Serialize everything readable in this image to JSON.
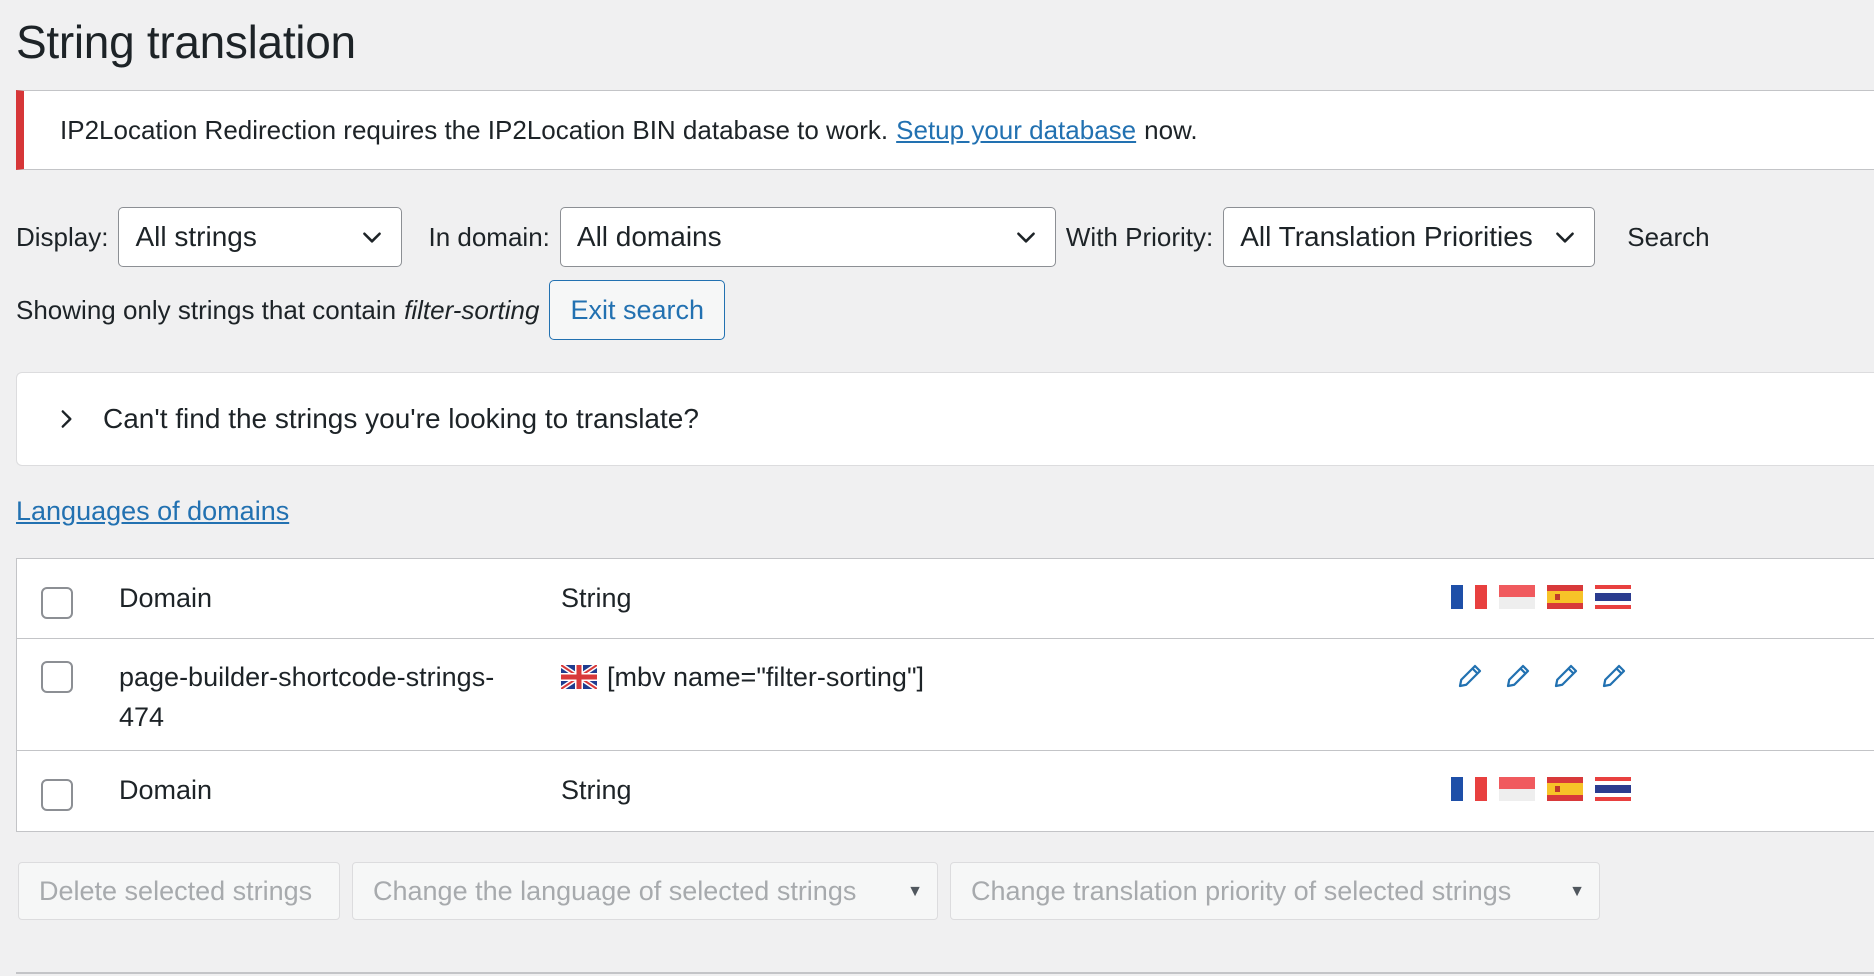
{
  "page": {
    "title": "String translation"
  },
  "notice": {
    "text_before": "IP2Location Redirection requires the IP2Location BIN database to work.",
    "link_text": "Setup your database",
    "text_after": "now.",
    "border_color": "#d63638"
  },
  "filters": {
    "display_label": "Display:",
    "display_value": "All strings",
    "domain_label": "In domain:",
    "domain_value": "All domains",
    "priority_label": "With Priority:",
    "priority_value": "All Translation Priorities",
    "search_label": "Search"
  },
  "search_status": {
    "prefix": "Showing only strings that contain",
    "term": "filter-sorting",
    "exit_button": "Exit search"
  },
  "help_box": {
    "text": "Can't find the strings you're looking to translate?"
  },
  "languages_link": "Languages of domains",
  "table": {
    "headers": {
      "domain": "Domain",
      "string": "String"
    },
    "header_flags": [
      "french-flag-icon",
      "indonesian-flag-icon",
      "spanish-flag-icon",
      "thai-flag-icon"
    ],
    "rows": [
      {
        "domain": "page-builder-shortcode-strings-474",
        "string_flag": "uk-flag-icon",
        "string": "[mbv name=\"filter-sorting\"]",
        "actions": [
          "edit-translation-icon",
          "edit-translation-icon",
          "edit-translation-icon",
          "edit-translation-icon"
        ]
      }
    ],
    "footers": {
      "domain": "Domain",
      "string": "String"
    }
  },
  "bulk_actions": {
    "delete": "Delete selected strings",
    "change_language": "Change the language of selected strings",
    "change_priority": "Change translation priority of selected strings"
  },
  "colors": {
    "link": "#2271b1",
    "accent": "#2271b1",
    "pencil": "#2271b1"
  }
}
